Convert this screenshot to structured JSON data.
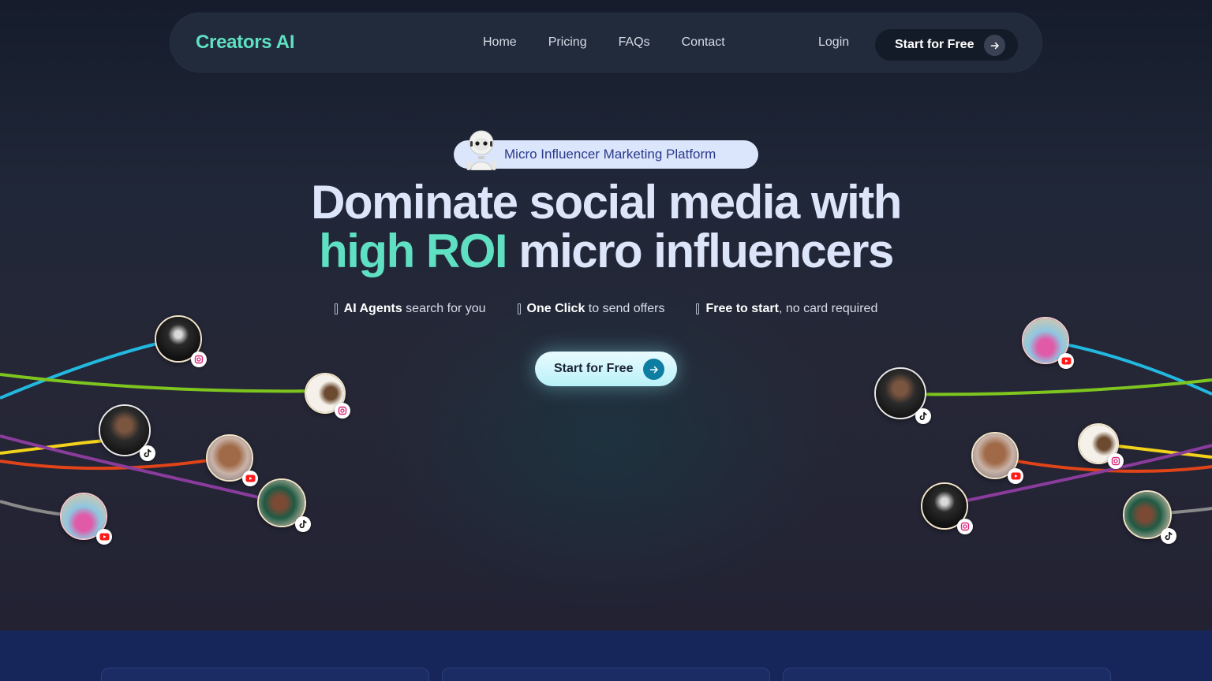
{
  "brand": {
    "name": "Creators AI"
  },
  "nav": {
    "links": [
      "Home",
      "Pricing",
      "FAQs",
      "Contact"
    ],
    "login": "Login",
    "cta": "Start for Free"
  },
  "hero": {
    "badge": "Micro Influencer Marketing Platform",
    "headline_line1": "Dominate social media with",
    "headline_accent": "high ROI",
    "headline_line2_rest": " micro influencers",
    "features": [
      {
        "bold": "AI Agents",
        "text": " search for you"
      },
      {
        "bold": "One Click",
        "text": " to send offers"
      },
      {
        "bold": "Free to start",
        "text": ", no card required"
      }
    ],
    "cta": "Start for Free"
  },
  "avatars": [
    {
      "side": "left",
      "platform": "instagram-icon"
    },
    {
      "side": "left",
      "platform": "instagram-icon"
    },
    {
      "side": "left",
      "platform": "tiktok-icon"
    },
    {
      "side": "left",
      "platform": "youtube-icon"
    },
    {
      "side": "left",
      "platform": "tiktok-icon"
    },
    {
      "side": "left",
      "platform": "youtube-icon"
    },
    {
      "side": "right",
      "platform": "youtube-icon"
    },
    {
      "side": "right",
      "platform": "tiktok-icon"
    },
    {
      "side": "right",
      "platform": "youtube-icon"
    },
    {
      "side": "right",
      "platform": "instagram-icon"
    },
    {
      "side": "right",
      "platform": "instagram-icon"
    },
    {
      "side": "right",
      "platform": "tiktok-icon"
    }
  ],
  "colors": {
    "accent": "#5fe0c2",
    "badge_bg": "#dbe5fb",
    "cta_arrow": "#0d7ea1",
    "line_colors": [
      "#22b8e0",
      "#7ec51f",
      "#f2d21a",
      "#e04418",
      "#8a3c9c",
      "#8a8a8a"
    ]
  }
}
